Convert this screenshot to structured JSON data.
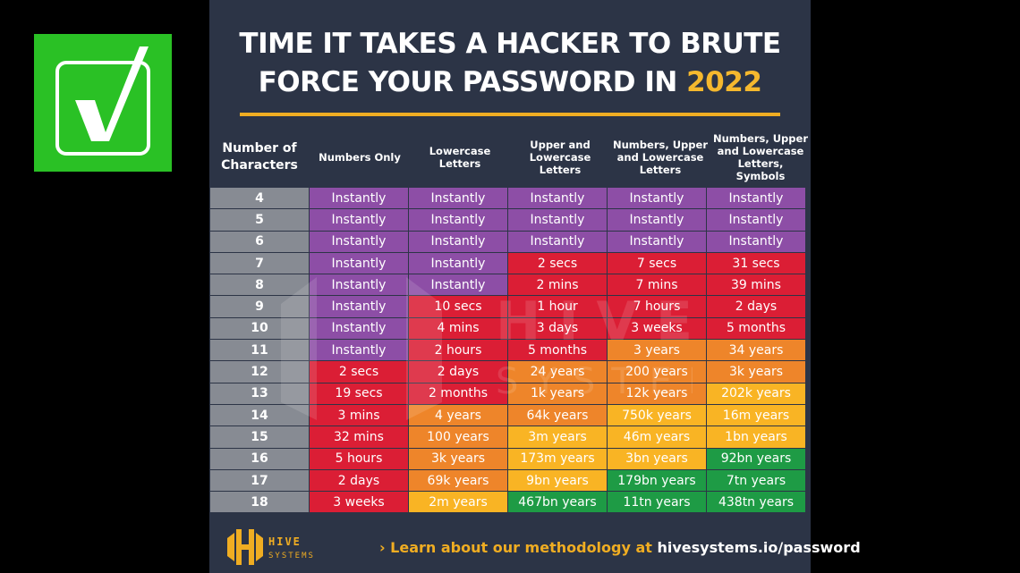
{
  "badge": {
    "icon": "checkmark-icon",
    "color": "#2ac125"
  },
  "header": {
    "title_line1": "TIME IT TAKES A HACKER TO BRUTE",
    "title_line2_prefix": "FORCE YOUR PASSWORD IN ",
    "title_year": "2022"
  },
  "colors": {
    "purple": "#8d4ea6",
    "red": "#db1e35",
    "orange": "#ee852a",
    "yellow": "#f9b424",
    "green": "#1e9b45",
    "gray": "#878b93",
    "background": "#2c3446",
    "accent": "#f0ad22"
  },
  "footer": {
    "logo_line1": "HIVE",
    "logo_line2": "SYSTEMS",
    "prefix": "› Learn about our methodology at ",
    "url": "hivesystems.io/password"
  },
  "chart_data": {
    "type": "table",
    "title": "TIME IT TAKES A HACKER TO BRUTE FORCE YOUR PASSWORD IN 2022",
    "row_header": "Number of Characters",
    "columns": [
      "Numbers Only",
      "Lowercase Letters",
      "Upper and Lowercase Letters",
      "Numbers, Upper and Lowercase Letters",
      "Numbers, Upper and Lowercase Letters, Symbols"
    ],
    "rows": [
      {
        "chars": "4",
        "values": [
          "Instantly",
          "Instantly",
          "Instantly",
          "Instantly",
          "Instantly"
        ],
        "colors": [
          "purple",
          "purple",
          "purple",
          "purple",
          "purple"
        ]
      },
      {
        "chars": "5",
        "values": [
          "Instantly",
          "Instantly",
          "Instantly",
          "Instantly",
          "Instantly"
        ],
        "colors": [
          "purple",
          "purple",
          "purple",
          "purple",
          "purple"
        ]
      },
      {
        "chars": "6",
        "values": [
          "Instantly",
          "Instantly",
          "Instantly",
          "Instantly",
          "Instantly"
        ],
        "colors": [
          "purple",
          "purple",
          "purple",
          "purple",
          "purple"
        ]
      },
      {
        "chars": "7",
        "values": [
          "Instantly",
          "Instantly",
          "2 secs",
          "7 secs",
          "31 secs"
        ],
        "colors": [
          "purple",
          "purple",
          "red",
          "red",
          "red"
        ]
      },
      {
        "chars": "8",
        "values": [
          "Instantly",
          "Instantly",
          "2 mins",
          "7 mins",
          "39 mins"
        ],
        "colors": [
          "purple",
          "purple",
          "red",
          "red",
          "red"
        ]
      },
      {
        "chars": "9",
        "values": [
          "Instantly",
          "10 secs",
          "1 hour",
          "7 hours",
          "2 days"
        ],
        "colors": [
          "purple",
          "red",
          "red",
          "red",
          "red"
        ]
      },
      {
        "chars": "10",
        "values": [
          "Instantly",
          "4 mins",
          "3 days",
          "3 weeks",
          "5 months"
        ],
        "colors": [
          "purple",
          "red",
          "red",
          "red",
          "red"
        ]
      },
      {
        "chars": "11",
        "values": [
          "Instantly",
          "2 hours",
          "5 months",
          "3 years",
          "34 years"
        ],
        "colors": [
          "purple",
          "red",
          "red",
          "orange",
          "orange"
        ]
      },
      {
        "chars": "12",
        "values": [
          "2 secs",
          "2 days",
          "24 years",
          "200 years",
          "3k years"
        ],
        "colors": [
          "red",
          "red",
          "orange",
          "orange",
          "orange"
        ]
      },
      {
        "chars": "13",
        "values": [
          "19 secs",
          "2 months",
          "1k years",
          "12k years",
          "202k years"
        ],
        "colors": [
          "red",
          "red",
          "orange",
          "orange",
          "yellow"
        ]
      },
      {
        "chars": "14",
        "values": [
          "3 mins",
          "4 years",
          "64k years",
          "750k years",
          "16m years"
        ],
        "colors": [
          "red",
          "orange",
          "orange",
          "yellow",
          "yellow"
        ]
      },
      {
        "chars": "15",
        "values": [
          "32 mins",
          "100 years",
          "3m years",
          "46m years",
          "1bn years"
        ],
        "colors": [
          "red",
          "orange",
          "yellow",
          "yellow",
          "yellow"
        ]
      },
      {
        "chars": "16",
        "values": [
          "5 hours",
          "3k years",
          "173m years",
          "3bn years",
          "92bn years"
        ],
        "colors": [
          "red",
          "orange",
          "yellow",
          "yellow",
          "green"
        ]
      },
      {
        "chars": "17",
        "values": [
          "2 days",
          "69k years",
          "9bn years",
          "179bn years",
          "7tn years"
        ],
        "colors": [
          "red",
          "orange",
          "yellow",
          "green",
          "green"
        ]
      },
      {
        "chars": "18",
        "values": [
          "3 weeks",
          "2m years",
          "467bn years",
          "11tn years",
          "438tn years"
        ],
        "colors": [
          "red",
          "yellow",
          "green",
          "green",
          "green"
        ]
      }
    ]
  }
}
